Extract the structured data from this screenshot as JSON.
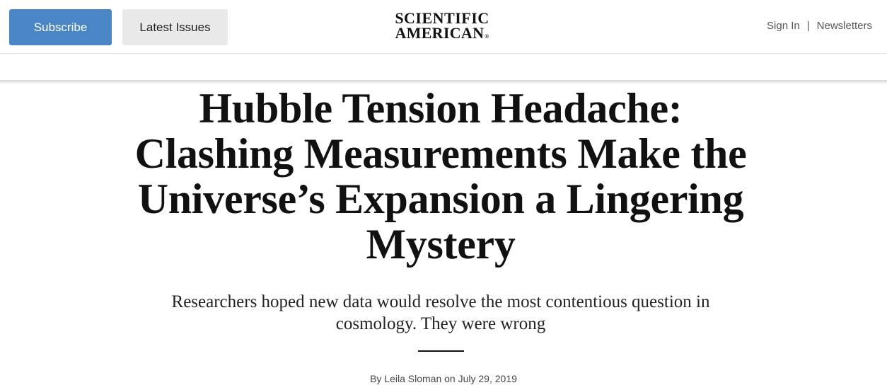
{
  "header": {
    "subscribe_label": "Subscribe",
    "latest_issues_label": "Latest Issues",
    "logo": {
      "line1": "SCIENTIFIC",
      "line2": "AMERICAN",
      "reg_mark": "®"
    },
    "sign_in_label": "Sign In",
    "separator": "|",
    "newsletters_label": "Newsletters"
  },
  "article": {
    "headline_lines": [
      "Hubble Tension Headache:",
      "Clashing Measurements Make the",
      "Universe’s Expansion a Lingering",
      "Mystery"
    ],
    "dek_lines": [
      "Researchers hoped new data would resolve the most contentious question in",
      "cosmology. They were wrong"
    ],
    "byline": {
      "prefix": "By",
      "author": "Leila Sloman",
      "on": "on",
      "date": "July 29, 2019"
    }
  },
  "colors": {
    "subscribe_bg": "#4a86c5",
    "latest_bg": "#e9e9e9",
    "text": "#111111"
  }
}
